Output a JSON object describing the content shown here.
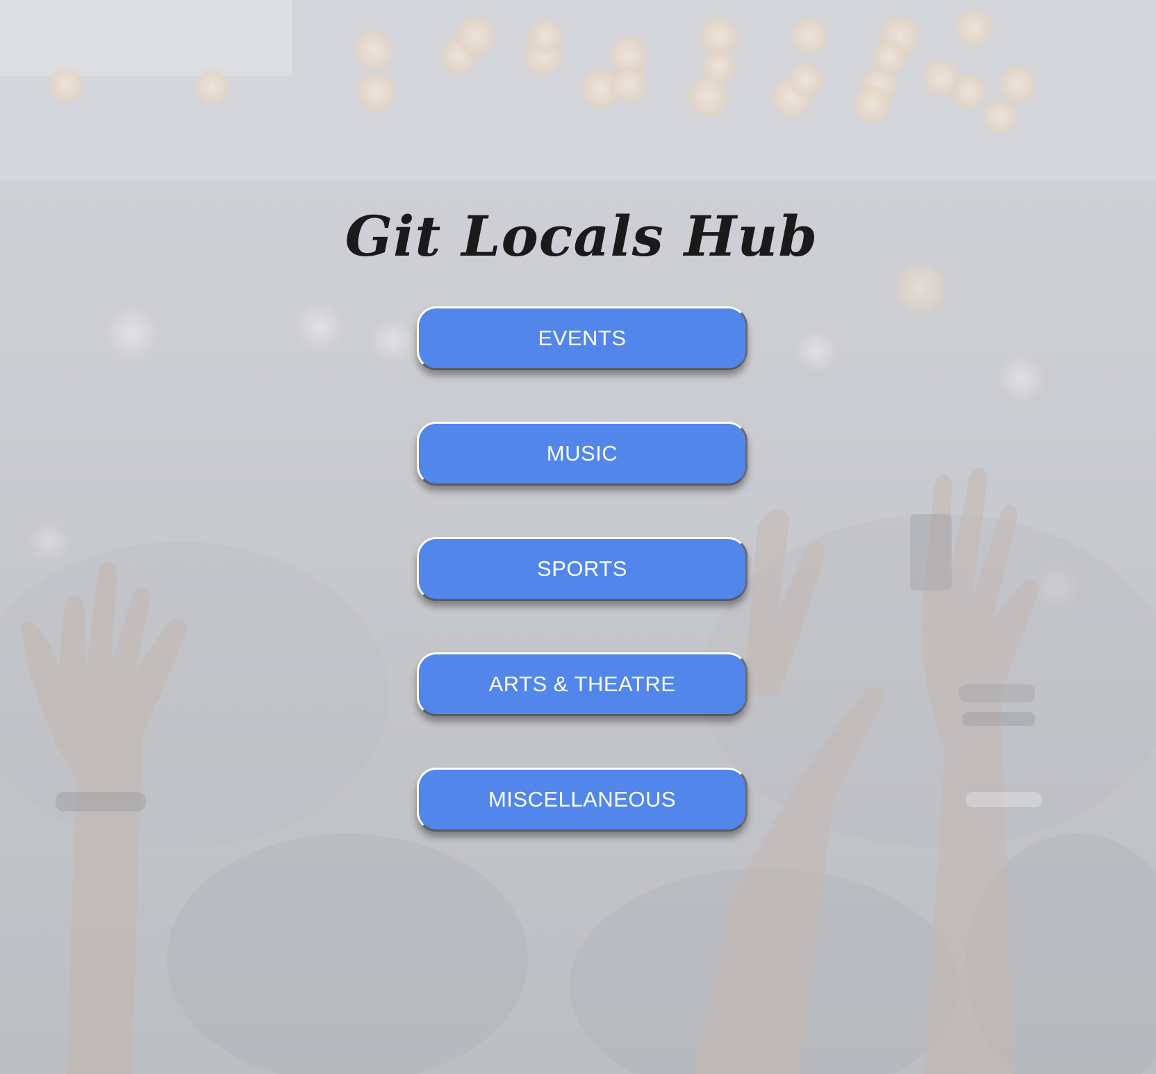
{
  "app": {
    "title": "Git Locals Hub"
  },
  "colors": {
    "button_background": "#5286eb",
    "button_text": "#ffffff",
    "title_text": "#1a1a1a",
    "page_overlay": "#d6d8dc"
  },
  "menu": {
    "items": [
      {
        "label": "EVENTS"
      },
      {
        "label": "MUSIC"
      },
      {
        "label": "SPORTS"
      },
      {
        "label": "ARTS & THEATRE"
      },
      {
        "label": "MISCELLANEOUS"
      }
    ]
  }
}
